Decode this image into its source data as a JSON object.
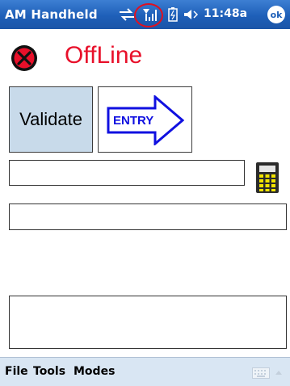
{
  "titlebar": {
    "app_title": "AM Handheld",
    "clock": "11:48a",
    "ok_label": "ok",
    "icons": [
      "sync-icon",
      "signal-icon",
      "battery-icon",
      "volume-icon"
    ]
  },
  "status": {
    "icon": "offline-status-icon",
    "text": "OffLine",
    "color": "#e8102a"
  },
  "buttons": {
    "validate": "Validate",
    "entry": "ENTRY",
    "validate_bg": "#c8daea"
  },
  "inputs": {
    "field1": "",
    "field2": "",
    "notes": ""
  },
  "menubar": {
    "items": [
      "File",
      "Tools",
      "Modes"
    ],
    "icons": [
      "keyboard-icon",
      "chevron-up-icon"
    ]
  },
  "colors": {
    "titlebar": "#1e5fb8",
    "menubar": "#d9e6f3",
    "accent_red": "#e8102a",
    "entry_blue": "#1010e0"
  }
}
